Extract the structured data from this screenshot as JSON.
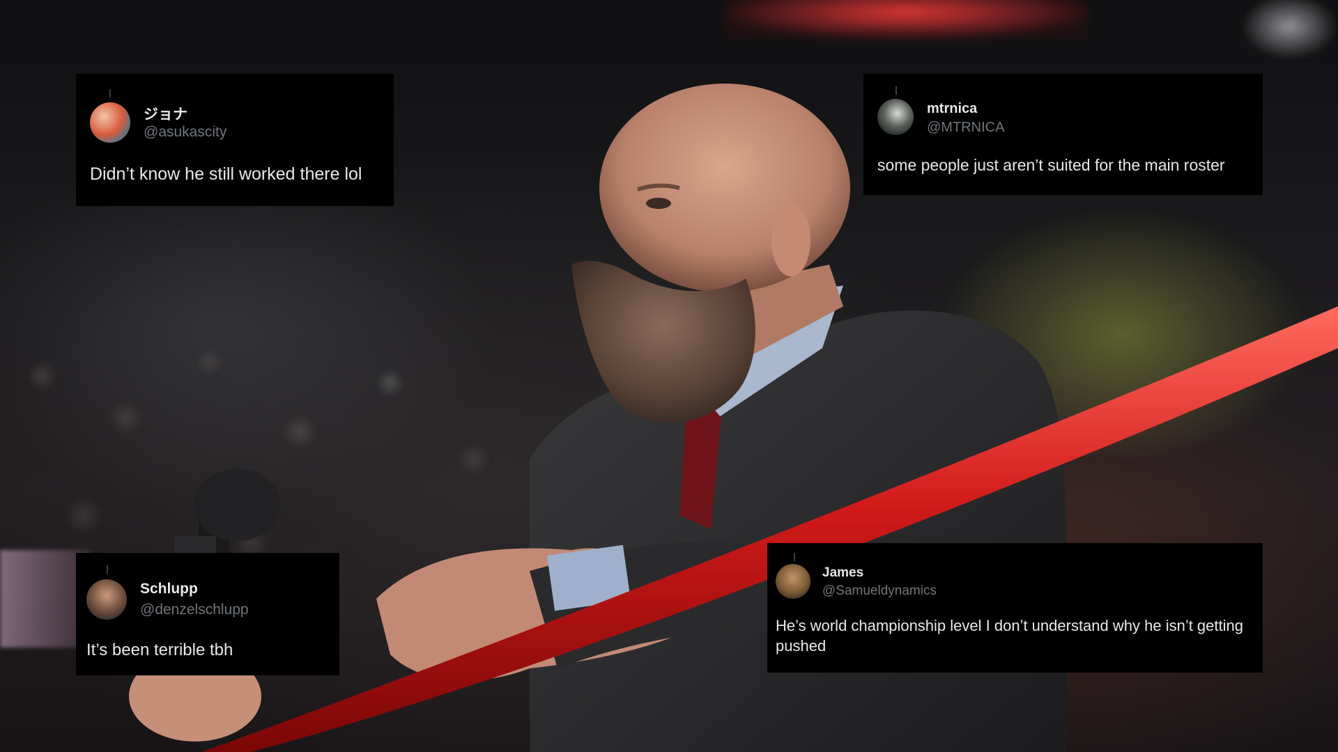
{
  "tweets": [
    {
      "display_name": "ジョナ",
      "handle": "@asukascity",
      "text": "Didn’t know he still worked there lol"
    },
    {
      "display_name": "mtrnica",
      "handle": "@MTRNICA",
      "text": "some people just aren’t suited for the main roster"
    },
    {
      "display_name": "Schlupp",
      "handle": "@denzelschlupp",
      "text": "It’s been terrible tbh"
    },
    {
      "display_name": "James",
      "handle": "@Samueldynamics",
      "text": "He’s world championship level I don’t understand why he isn’t getting pushed"
    }
  ]
}
